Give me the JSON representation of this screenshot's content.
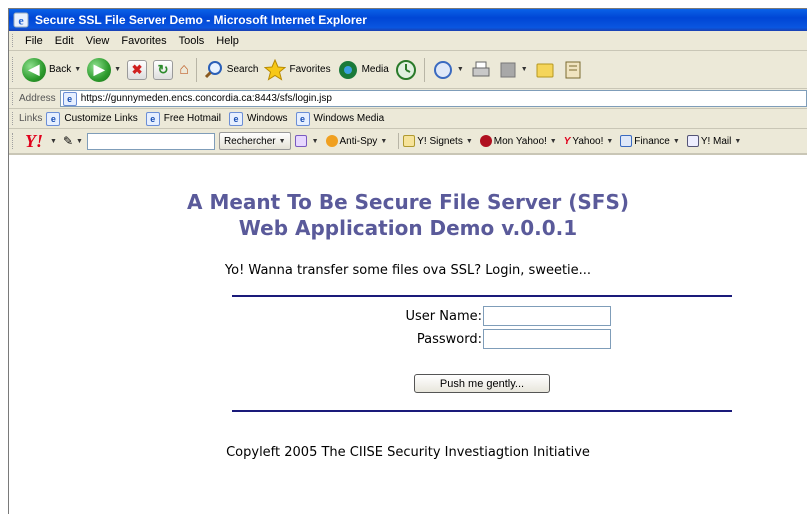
{
  "window": {
    "title": "Secure SSL File Server Demo - Microsoft Internet Explorer"
  },
  "menubar": {
    "items": [
      "File",
      "Edit",
      "View",
      "Favorites",
      "Tools",
      "Help"
    ]
  },
  "toolbar": {
    "back_label": "Back",
    "search_label": "Search",
    "favorites_label": "Favorites",
    "media_label": "Media"
  },
  "address": {
    "label": "Address",
    "url": "https://gunnymeden.encs.concordia.ca:8443/sfs/login.jsp"
  },
  "links": {
    "label": "Links",
    "items": [
      "Customize Links",
      "Free Hotmail",
      "Windows",
      "Windows Media"
    ]
  },
  "yahoo_toolbar": {
    "logo": "Y!",
    "search_button": "Rechercher",
    "antispy": "Anti-Spy",
    "signets": "Y! Signets",
    "my_yahoo": "Mon Yahoo!",
    "yahoo": "Yahoo!",
    "finance": "Finance",
    "mail": "Y! Mail"
  },
  "page": {
    "heading_line1": "A Meant To Be Secure File Server (SFS)",
    "heading_line2": "Web Application Demo v.0.0.1",
    "subtitle": "Yo! Wanna transfer some files ova SSL? Login, sweetie...",
    "username_label": "User Name:",
    "password_label": "Password:",
    "submit_label": "Push me gently...",
    "footer": "Copyleft 2005 The CIISE Security Investiagtion Initiative",
    "heading_color": "#5a5a9a",
    "rule_color": "#1a1a7a"
  }
}
